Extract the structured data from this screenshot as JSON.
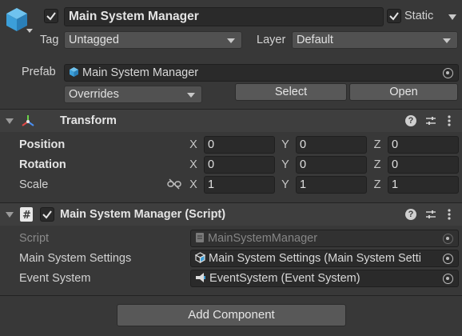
{
  "header": {
    "object_name": "Main System Manager",
    "active": true,
    "static_label": "Static",
    "static": true,
    "tag_label": "Tag",
    "tag_value": "Untagged",
    "layer_label": "Layer",
    "layer_value": "Default"
  },
  "prefab": {
    "label": "Prefab",
    "value": "Main System Manager",
    "overrides_label": "Overrides",
    "select_label": "Select",
    "open_label": "Open"
  },
  "transform": {
    "title": "Transform",
    "rows": [
      {
        "label": "Position",
        "x": "0",
        "y": "0",
        "z": "0"
      },
      {
        "label": "Rotation",
        "x": "0",
        "y": "0",
        "z": "0"
      },
      {
        "label": "Scale",
        "x": "1",
        "y": "1",
        "z": "1"
      }
    ],
    "axes": [
      "X",
      "Y",
      "Z"
    ]
  },
  "script_component": {
    "title": "Main System Manager (Script)",
    "enabled": true,
    "script_label": "Script",
    "script_value": "MainSystemManager",
    "settings_label": "Main System Settings",
    "settings_value": "Main System Settings (Main System Setti",
    "event_label": "Event System",
    "event_value": "EventSystem (Event System)"
  },
  "add_component_label": "Add Component"
}
